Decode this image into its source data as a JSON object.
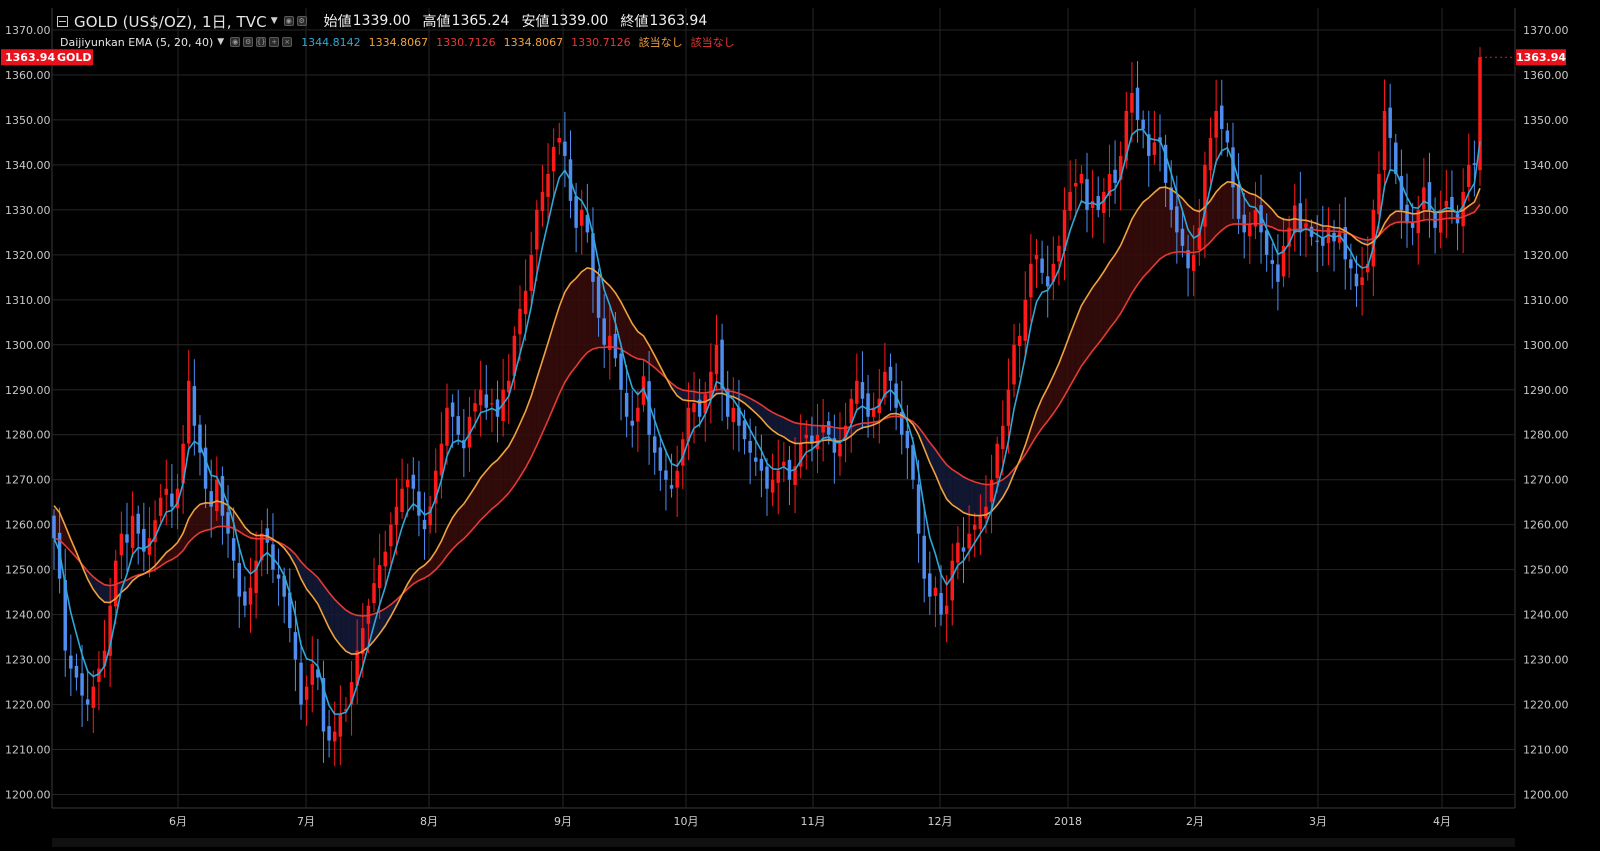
{
  "header": {
    "symbol_title": "GOLD (US$/OZ), 1日, TVC",
    "ohlc": [
      {
        "label": "始値",
        "value": "1339.00"
      },
      {
        "label": "高値",
        "value": "1365.24"
      },
      {
        "label": "安値",
        "value": "1339.00"
      },
      {
        "label": "終値",
        "value": "1363.94"
      }
    ]
  },
  "indicator": {
    "name": "Daijiyunkan EMA (5, 20, 40)",
    "values": [
      {
        "text": "1344.8142",
        "color": "#2fa8d8"
      },
      {
        "text": "1334.8067",
        "color": "#f0a23c"
      },
      {
        "text": "1330.7126",
        "color": "#e53935"
      },
      {
        "text": "1334.8067",
        "color": "#f0a23c"
      },
      {
        "text": "1330.7126",
        "color": "#e53935"
      },
      {
        "text": "該当なし",
        "color": "#f0a23c"
      },
      {
        "text": "該当なし",
        "color": "#e53935"
      }
    ]
  },
  "price_scale": {
    "ticks": [
      "1370.00",
      "1360.00",
      "1350.00",
      "1340.00",
      "1330.00",
      "1320.00",
      "1310.00",
      "1300.00",
      "1290.00",
      "1280.00",
      "1270.00",
      "1260.00",
      "1250.00",
      "1240.00",
      "1230.00",
      "1220.00",
      "1210.00",
      "1200.00"
    ],
    "last_price_label": "1363.94",
    "left_badge": {
      "price": "1363.94",
      "symbol": "GOLD"
    }
  },
  "time_scale": {
    "labels": [
      "6月",
      "7月",
      "8月",
      "9月",
      "10月",
      "11月",
      "12月",
      "2018",
      "2月",
      "3月",
      "4月"
    ]
  },
  "colors": {
    "background": "#000000",
    "grid": "#262626",
    "up_candle": "#ff1a1a",
    "down_candle": "#4f8ef0",
    "ema_fast": "#2fa8d8",
    "ema_mid": "#f0a23c",
    "ema_slow": "#e53935",
    "last_price_bg": "#e8121c",
    "cloud_bull": "#3a0c0c",
    "cloud_bear": "#141a3a"
  },
  "chart_data": {
    "type": "candlestick",
    "symbol": "GOLD",
    "timeframe": "1D",
    "ylim": [
      1197,
      1374
    ],
    "price_ticks": [
      1370,
      1360,
      1350,
      1340,
      1330,
      1320,
      1310,
      1300,
      1290,
      1280,
      1270,
      1260,
      1250,
      1240,
      1230,
      1220,
      1210,
      1200
    ],
    "last_close": 1363.94,
    "series": [
      {
        "role": "candles",
        "up_color": "#ff1a1a",
        "down_color": "#4f8ef0"
      },
      {
        "role": "ema_5",
        "color": "#2fa8d8"
      },
      {
        "role": "ema_20",
        "color": "#f0a23c"
      },
      {
        "role": "ema_40",
        "color": "#e53935"
      }
    ],
    "closes": [
      1257,
      1248,
      1232,
      1228,
      1226,
      1222,
      1220,
      1224,
      1228,
      1232,
      1242,
      1252,
      1258,
      1256,
      1262,
      1258,
      1254,
      1257,
      1261,
      1266,
      1268,
      1264,
      1268,
      1278,
      1292,
      1282,
      1276,
      1268,
      1264,
      1270,
      1262,
      1258,
      1252,
      1244,
      1242,
      1246,
      1252,
      1258,
      1256,
      1250,
      1248,
      1244,
      1237,
      1230,
      1220,
      1224,
      1229,
      1226,
      1214,
      1212,
      1214,
      1218,
      1219,
      1225,
      1232,
      1237,
      1242,
      1247,
      1251,
      1254,
      1260,
      1264,
      1268,
      1270,
      1268,
      1262,
      1259,
      1264,
      1272,
      1278,
      1286,
      1284,
      1280,
      1277,
      1284,
      1287,
      1290,
      1286,
      1287,
      1284,
      1290,
      1292,
      1302,
      1308,
      1312,
      1320,
      1330,
      1334,
      1338,
      1344,
      1346,
      1342,
      1332,
      1326,
      1330,
      1325,
      1314,
      1306,
      1300,
      1302,
      1297,
      1290,
      1284,
      1282,
      1286,
      1293,
      1280,
      1276,
      1272,
      1270,
      1268,
      1272,
      1279,
      1286,
      1287,
      1284,
      1289,
      1294,
      1300,
      1290,
      1284,
      1286,
      1282,
      1279,
      1276,
      1274,
      1272,
      1268,
      1270,
      1272,
      1274,
      1270,
      1273,
      1278,
      1280,
      1278,
      1280,
      1282,
      1280,
      1276,
      1278,
      1282,
      1288,
      1292,
      1288,
      1284,
      1286,
      1288,
      1294,
      1292,
      1286,
      1280,
      1277,
      1270,
      1258,
      1248,
      1244,
      1246,
      1240,
      1242,
      1252,
      1256,
      1254,
      1258,
      1260,
      1262,
      1264,
      1270,
      1278,
      1282,
      1290,
      1300,
      1302,
      1310,
      1318,
      1320,
      1316,
      1313,
      1318,
      1322,
      1330,
      1334,
      1336,
      1338,
      1330,
      1332,
      1330,
      1334,
      1338,
      1336,
      1342,
      1352,
      1356,
      1350,
      1348,
      1342,
      1345,
      1345,
      1336,
      1330,
      1325,
      1322,
      1317,
      1320,
      1326,
      1340,
      1346,
      1352,
      1348,
      1345,
      1335,
      1328,
      1325,
      1327,
      1330,
      1325,
      1320,
      1318,
      1314,
      1322,
      1326,
      1331,
      1325,
      1327,
      1324,
      1323,
      1322,
      1326,
      1323,
      1325,
      1319,
      1317,
      1313,
      1315,
      1318,
      1330,
      1338,
      1352,
      1346,
      1338,
      1330,
      1327,
      1326,
      1330,
      1335,
      1330,
      1326,
      1330,
      1332,
      1330,
      1327,
      1334,
      1340,
      1340,
      1363.94
    ]
  }
}
